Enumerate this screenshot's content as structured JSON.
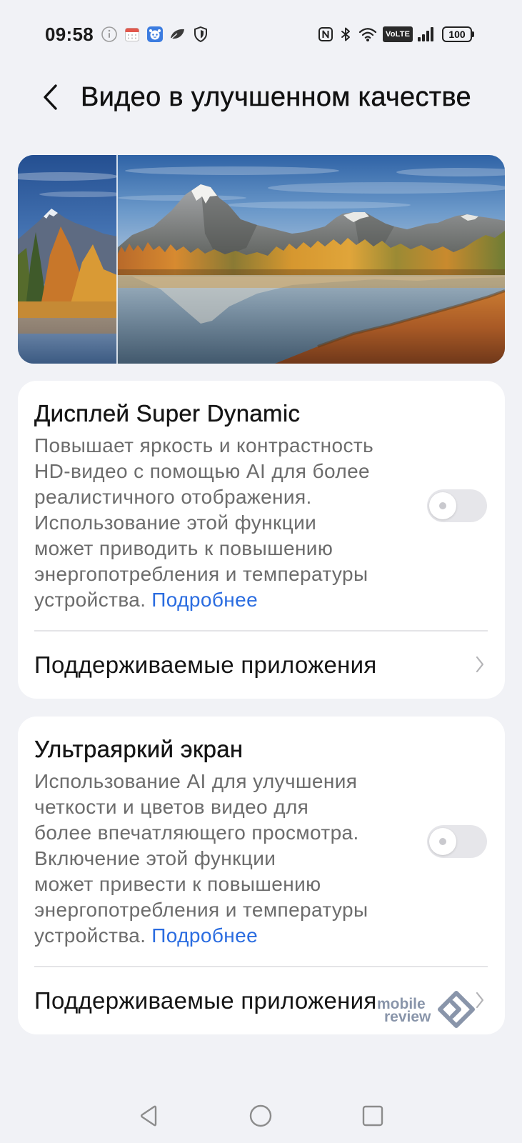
{
  "status_bar": {
    "time": "09:58",
    "notification_icons": [
      "info-icon",
      "calendar-icon",
      "assistant-bot-icon",
      "leaf-icon",
      "shield-icon"
    ],
    "system_icons": [
      "nfc-icon",
      "bluetooth-icon",
      "wifi-icon",
      "volte-badge",
      "signal-icon",
      "battery-icon"
    ],
    "volte": "VoLTE",
    "battery_level": "100"
  },
  "header": {
    "back_icon": "back-arrow-icon",
    "title": "Видео в улучшенном качестве"
  },
  "sections": [
    {
      "title": "Дисплей Super Dynamic",
      "description_lines": [
        "Повышает яркость и контрастность",
        "HD-видео с помощью AI для более",
        "реалистичного отображения.",
        "Использование этой функции",
        "может приводить к повышению",
        "энергопотребления и температуры",
        "устройства."
      ],
      "link": "Подробнее",
      "toggle_on": false,
      "supported_apps_label": "Поддерживаемые приложения",
      "chevron_icon": "chevron-right-icon"
    },
    {
      "title": "Ультраяркий экран",
      "description_lines": [
        "Использование AI для улучшения",
        "четкости и цветов видео для",
        "более впечатляющего просмотра.",
        "Включение этой функции",
        "может привести к повышению",
        "энергопотребления и температуры",
        "устройства."
      ],
      "link": "Подробнее",
      "toggle_on": false,
      "supported_apps_label": "Поддерживаемые приложения",
      "chevron_icon": "chevron-right-icon"
    }
  ],
  "watermark": {
    "line1": "mobile",
    "line2": "review",
    "logo_icon": "mobile-review-logo-icon"
  },
  "nav_bar": {
    "icons": [
      "nav-back-icon",
      "nav-home-icon",
      "nav-recents-icon"
    ]
  },
  "colors": {
    "background": "#f1f2f6",
    "card": "#ffffff",
    "title_text": "#151515",
    "description_text": "#6c6c6c",
    "link": "#2a6ce0",
    "toggle_track_off": "#e6e6ea",
    "divider": "#e4e4e7",
    "nav_icons": "#8c8c8c",
    "watermark": "#7d8aa1",
    "assistant_icon": "#3c7ce0",
    "calendar_accent": "#e2574c"
  }
}
